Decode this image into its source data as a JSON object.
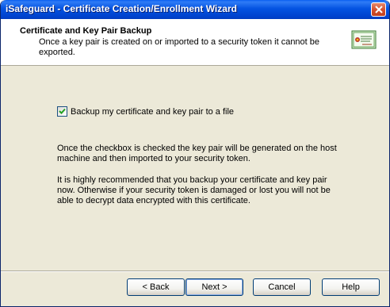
{
  "window": {
    "title": "iSafeguard - Certificate Creation/Enrollment Wizard",
    "close_icon": "close-icon"
  },
  "header": {
    "title": "Certificate and Key Pair Backup",
    "subtitle": "Once a key pair is created on or imported to a security token it cannot be exported.",
    "icon": "certificate-icon"
  },
  "options": {
    "backup_checkbox": {
      "label": "Backup my certificate and key pair to a file",
      "checked": true
    }
  },
  "body": {
    "paragraph1": "Once the checkbox is checked the key pair will be generated on the host machine and then imported to your security token.",
    "paragraph2": "It is highly recommended that you backup your certificate and key pair now. Otherwise if your security token is damaged or lost you will not be able to decrypt data encrypted with this certificate."
  },
  "buttons": {
    "back": "< Back",
    "next": "Next >",
    "cancel": "Cancel",
    "help": "Help"
  }
}
